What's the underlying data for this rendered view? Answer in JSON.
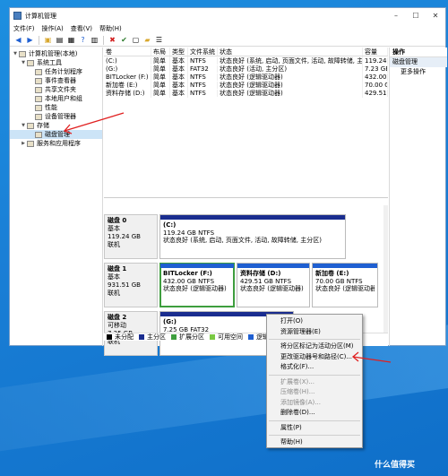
{
  "window": {
    "title": "计算机管理"
  },
  "menu": [
    "文件(F)",
    "操作(A)",
    "查看(V)",
    "帮助(H)"
  ],
  "tree": [
    {
      "label": "计算机管理(本地)",
      "level": 0,
      "expanded": true
    },
    {
      "label": "系统工具",
      "level": 1,
      "expanded": true
    },
    {
      "label": "任务计划程序",
      "level": 2
    },
    {
      "label": "事件查看器",
      "level": 2
    },
    {
      "label": "共享文件夹",
      "level": 2
    },
    {
      "label": "本地用户和组",
      "level": 2
    },
    {
      "label": "性能",
      "level": 2
    },
    {
      "label": "设备管理器",
      "level": 2
    },
    {
      "label": "存储",
      "level": 1,
      "expanded": true
    },
    {
      "label": "磁盘管理",
      "level": 2,
      "selected": true
    },
    {
      "label": "服务和应用程序",
      "level": 1
    }
  ],
  "volumes": {
    "headers": [
      "卷",
      "布局",
      "类型",
      "文件系统",
      "状态",
      "容量"
    ],
    "rows": [
      [
        "(C:)",
        "简单",
        "基本",
        "NTFS",
        "状态良好 (系统, 启动, 页面文件, 活动, 故障转储, 主分区)",
        "119.24 GB"
      ],
      [
        "(G:)",
        "简单",
        "基本",
        "FAT32",
        "状态良好 (活动, 主分区)",
        "7.23 GB"
      ],
      [
        "BITLocker (F:)",
        "简单",
        "基本",
        "NTFS",
        "状态良好 (逻辑驱动器)",
        "432.00 GB"
      ],
      [
        "新加卷 (E:)",
        "简单",
        "基本",
        "NTFS",
        "状态良好 (逻辑驱动器)",
        "70.00 GB"
      ],
      [
        "资料存储 (D:)",
        "简单",
        "基本",
        "NTFS",
        "状态良好 (逻辑驱动器)",
        "429.51 GB"
      ]
    ]
  },
  "disks": [
    {
      "name": "磁盘 0",
      "type": "基本",
      "size": "119.24 GB",
      "status": "联机",
      "parts": [
        {
          "name": "(C:)",
          "size": "119.24 GB NTFS",
          "status": "状态良好 (系统, 启动, 页面文件, 活动, 故障转储, 主分区)"
        }
      ]
    },
    {
      "name": "磁盘 1",
      "type": "基本",
      "size": "931.51 GB",
      "status": "联机",
      "parts": [
        {
          "name": "BITLocker  (F:)",
          "size": "432.00 GB NTFS",
          "status": "状态良好 (逻辑驱动器)"
        },
        {
          "name": "资料存储  (D:)",
          "size": "429.51 GB NTFS",
          "status": "状态良好 (逻辑驱动器)"
        },
        {
          "name": "新加卷  (E:)",
          "size": "70.00 GB NTFS",
          "status": "状态良好 (逻辑驱动器)"
        }
      ]
    },
    {
      "name": "磁盘 2",
      "type": "可移动",
      "size": "7.25 GB",
      "status": "联机",
      "parts": [
        {
          "name": "(G:)",
          "size": "7.25 GB FAT32",
          "status": "状态良好 (活动, 主分区)"
        }
      ]
    }
  ],
  "legend": [
    "未分配",
    "主分区",
    "扩展分区",
    "可用空间",
    "逻辑驱动器"
  ],
  "legend_colors": [
    "#000000",
    "#1a2d8f",
    "#3e9e3e",
    "#7ac943",
    "#1f5fd1"
  ],
  "actions": {
    "header": "操作",
    "section": "磁盘管理",
    "more": "更多操作"
  },
  "context_menu": [
    {
      "label": "打开(O)",
      "enabled": true
    },
    {
      "label": "资源管理器(E)",
      "enabled": true
    },
    {
      "sep": true
    },
    {
      "label": "将分区标记为活动分区(M)",
      "enabled": true
    },
    {
      "label": "更改驱动器号和路径(C)...",
      "enabled": true
    },
    {
      "label": "格式化(F)...",
      "enabled": true
    },
    {
      "sep": true
    },
    {
      "label": "扩展卷(X)...",
      "enabled": false
    },
    {
      "label": "压缩卷(H)...",
      "enabled": false
    },
    {
      "label": "添加镜像(A)...",
      "enabled": false
    },
    {
      "label": "删除卷(D)...",
      "enabled": true
    },
    {
      "sep": true
    },
    {
      "label": "属性(P)",
      "enabled": true
    },
    {
      "sep": true
    },
    {
      "label": "帮助(H)",
      "enabled": true
    }
  ],
  "watermark": "什么值得买"
}
